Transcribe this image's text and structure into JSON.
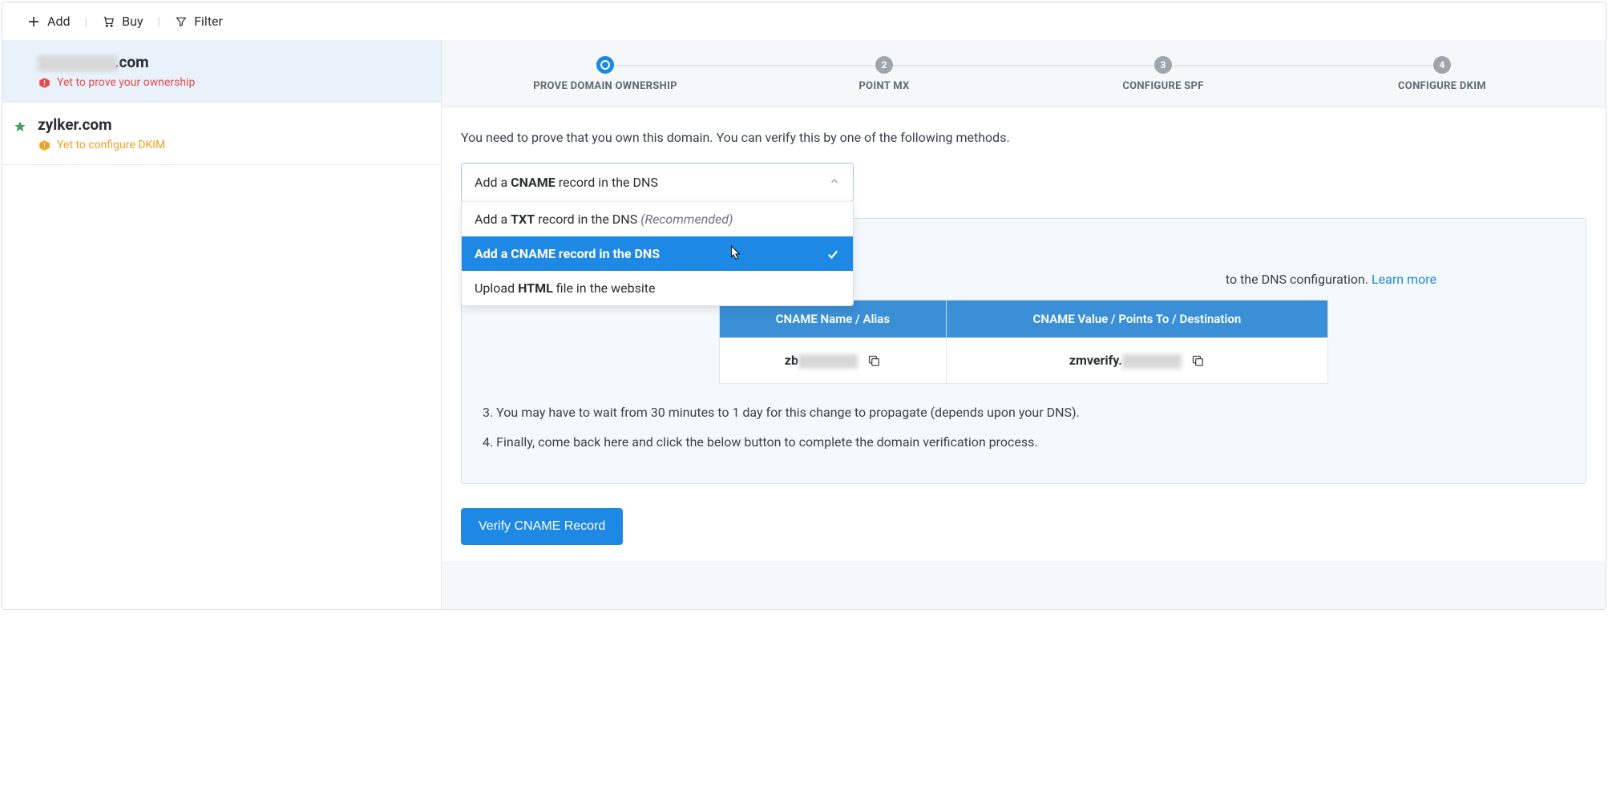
{
  "toolbar": {
    "add": "Add",
    "buy": "Buy",
    "filter": "Filter"
  },
  "sidebar": {
    "domains": [
      {
        "suffix": ".com",
        "status": "Yet to prove your ownership",
        "statusColor": "red",
        "blurredPrefix": true
      },
      {
        "name": "zylker.com",
        "status": "Yet to configure DKIM",
        "statusColor": "orange",
        "starred": true
      }
    ]
  },
  "stepper": {
    "steps": [
      {
        "label": "PROVE DOMAIN OWNERSHIP",
        "active": true
      },
      {
        "label": "POINT MX",
        "num": "2"
      },
      {
        "label": "CONFIGURE SPF",
        "num": "3"
      },
      {
        "label": "CONFIGURE DKIM",
        "num": "4"
      }
    ]
  },
  "main": {
    "intro": "You need to prove that you own this domain. You can verify this by one of the following methods.",
    "dropdown": {
      "trigger_pre": "Add a ",
      "trigger_bold": "CNAME",
      "trigger_post": " record in the DNS",
      "options": [
        {
          "pre": "Add a ",
          "bold": "TXT",
          "post": " record in the DNS ",
          "rec": "(Recommended)"
        },
        {
          "text": "Add a CNAME record in the DNS",
          "selected": true
        },
        {
          "pre": "Upload ",
          "bold": "HTML",
          "post": " file in the website"
        }
      ]
    },
    "info": {
      "line1_tail": "to the DNS configuration. ",
      "learn": "Learn more",
      "table": {
        "h1": "CNAME Name / Alias",
        "h2": "CNAME Value / Points To / Destination",
        "v1": "zb",
        "v2": "zmverify."
      },
      "step3": "3. You may have to wait from 30 minutes to 1 day for this change to propagate (depends upon your DNS).",
      "step4": "4. Finally, come back here and click the below button to complete the domain verification process."
    },
    "verify": "Verify CNAME Record"
  }
}
